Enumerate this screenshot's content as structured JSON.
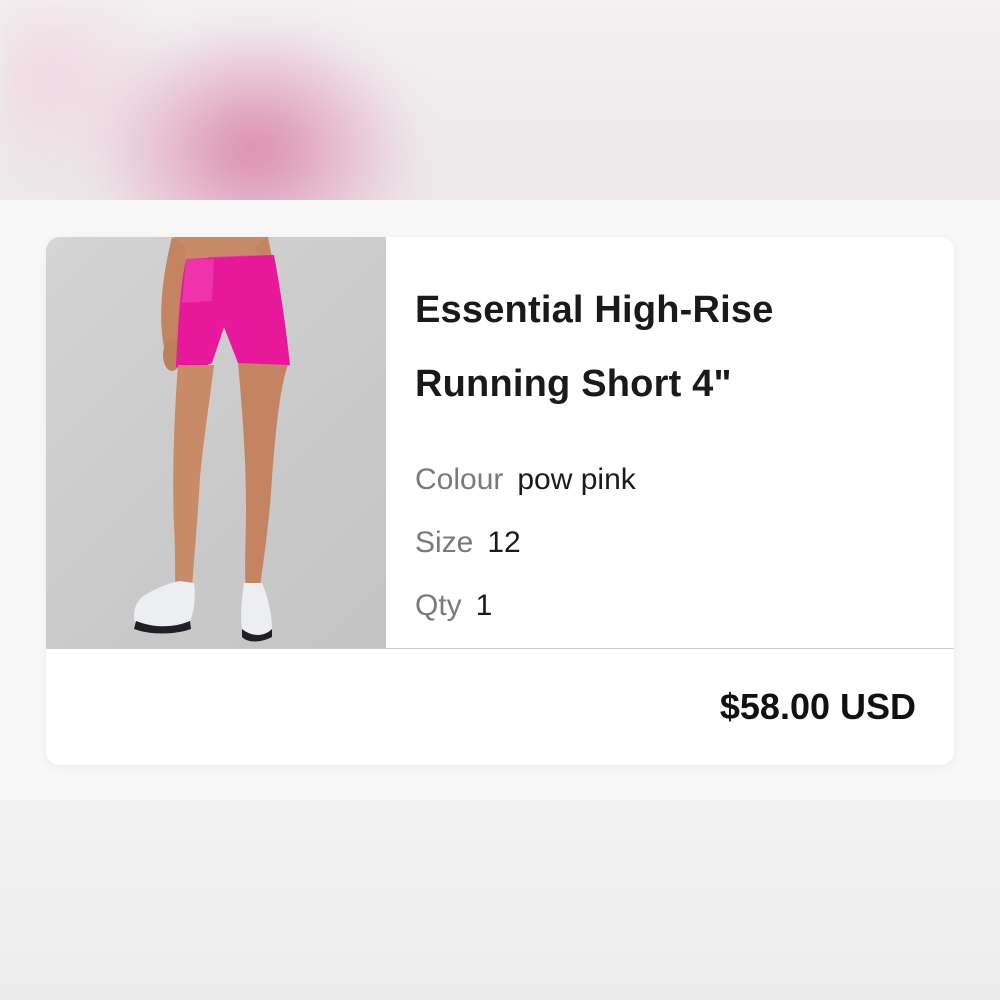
{
  "product": {
    "title_line1": "Essential High-Rise",
    "title_line2": "Running Short 4\"",
    "image_icon": "product-photo-pink-running-shorts",
    "colors": {
      "accent": "#e8189a",
      "text": "#1a1a1a",
      "label": "#7a7a7a"
    }
  },
  "attributes": {
    "colour": {
      "label": "Colour",
      "value": "pow pink"
    },
    "size": {
      "label": "Size",
      "value": "12"
    },
    "qty": {
      "label": "Qty",
      "value": "1"
    }
  },
  "total": {
    "price": "$58.00 USD"
  }
}
